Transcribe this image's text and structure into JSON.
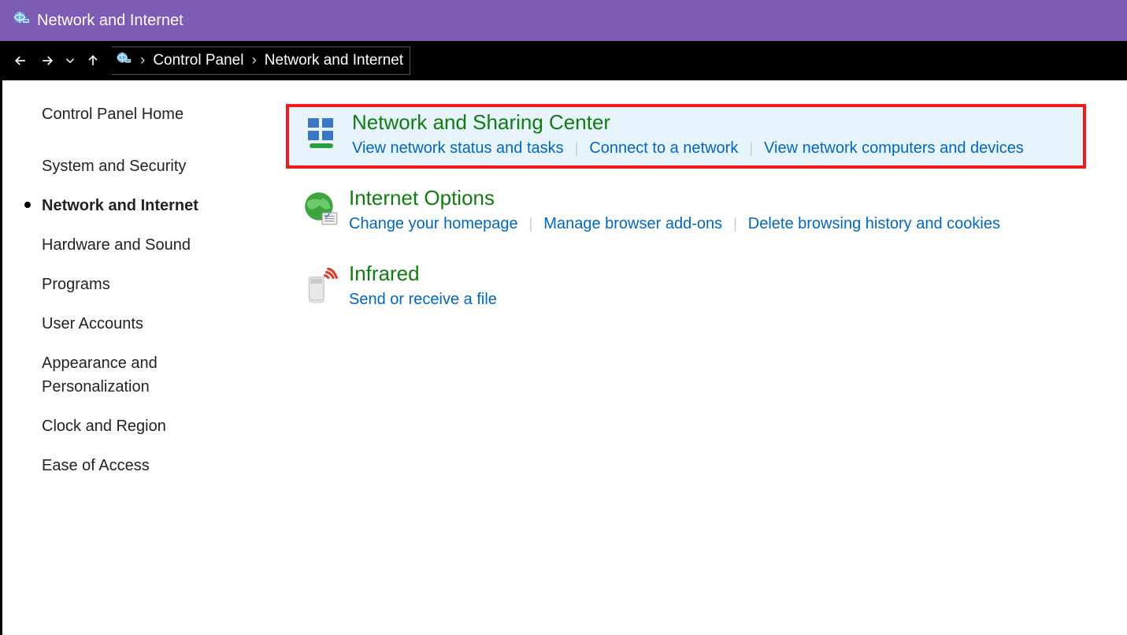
{
  "window": {
    "title": "Network and Internet"
  },
  "breadcrumb": {
    "items": [
      "Control Panel",
      "Network and Internet"
    ]
  },
  "sidebar": {
    "home": "Control Panel Home",
    "items": [
      "System and Security",
      "Network and Internet",
      "Hardware and Sound",
      "Programs",
      "User Accounts",
      "Appearance and Personalization",
      "Clock and Region",
      "Ease of Access"
    ],
    "current_index": 1
  },
  "sections": [
    {
      "title": "Network and Sharing Center",
      "links": [
        "View network status and tasks",
        "Connect to a network",
        "View network computers and devices"
      ],
      "highlighted": true
    },
    {
      "title": "Internet Options",
      "links": [
        "Change your homepage",
        "Manage browser add-ons",
        "Delete browsing history and cookies"
      ],
      "highlighted": false
    },
    {
      "title": "Infrared",
      "links": [
        "Send or receive a file"
      ],
      "highlighted": false
    }
  ],
  "colors": {
    "titlebar": "#7c5cb5",
    "section_title": "#107c10",
    "link": "#0067c0",
    "highlight_bg": "#e8f4fc",
    "highlight_border": "#ee1c1c"
  }
}
